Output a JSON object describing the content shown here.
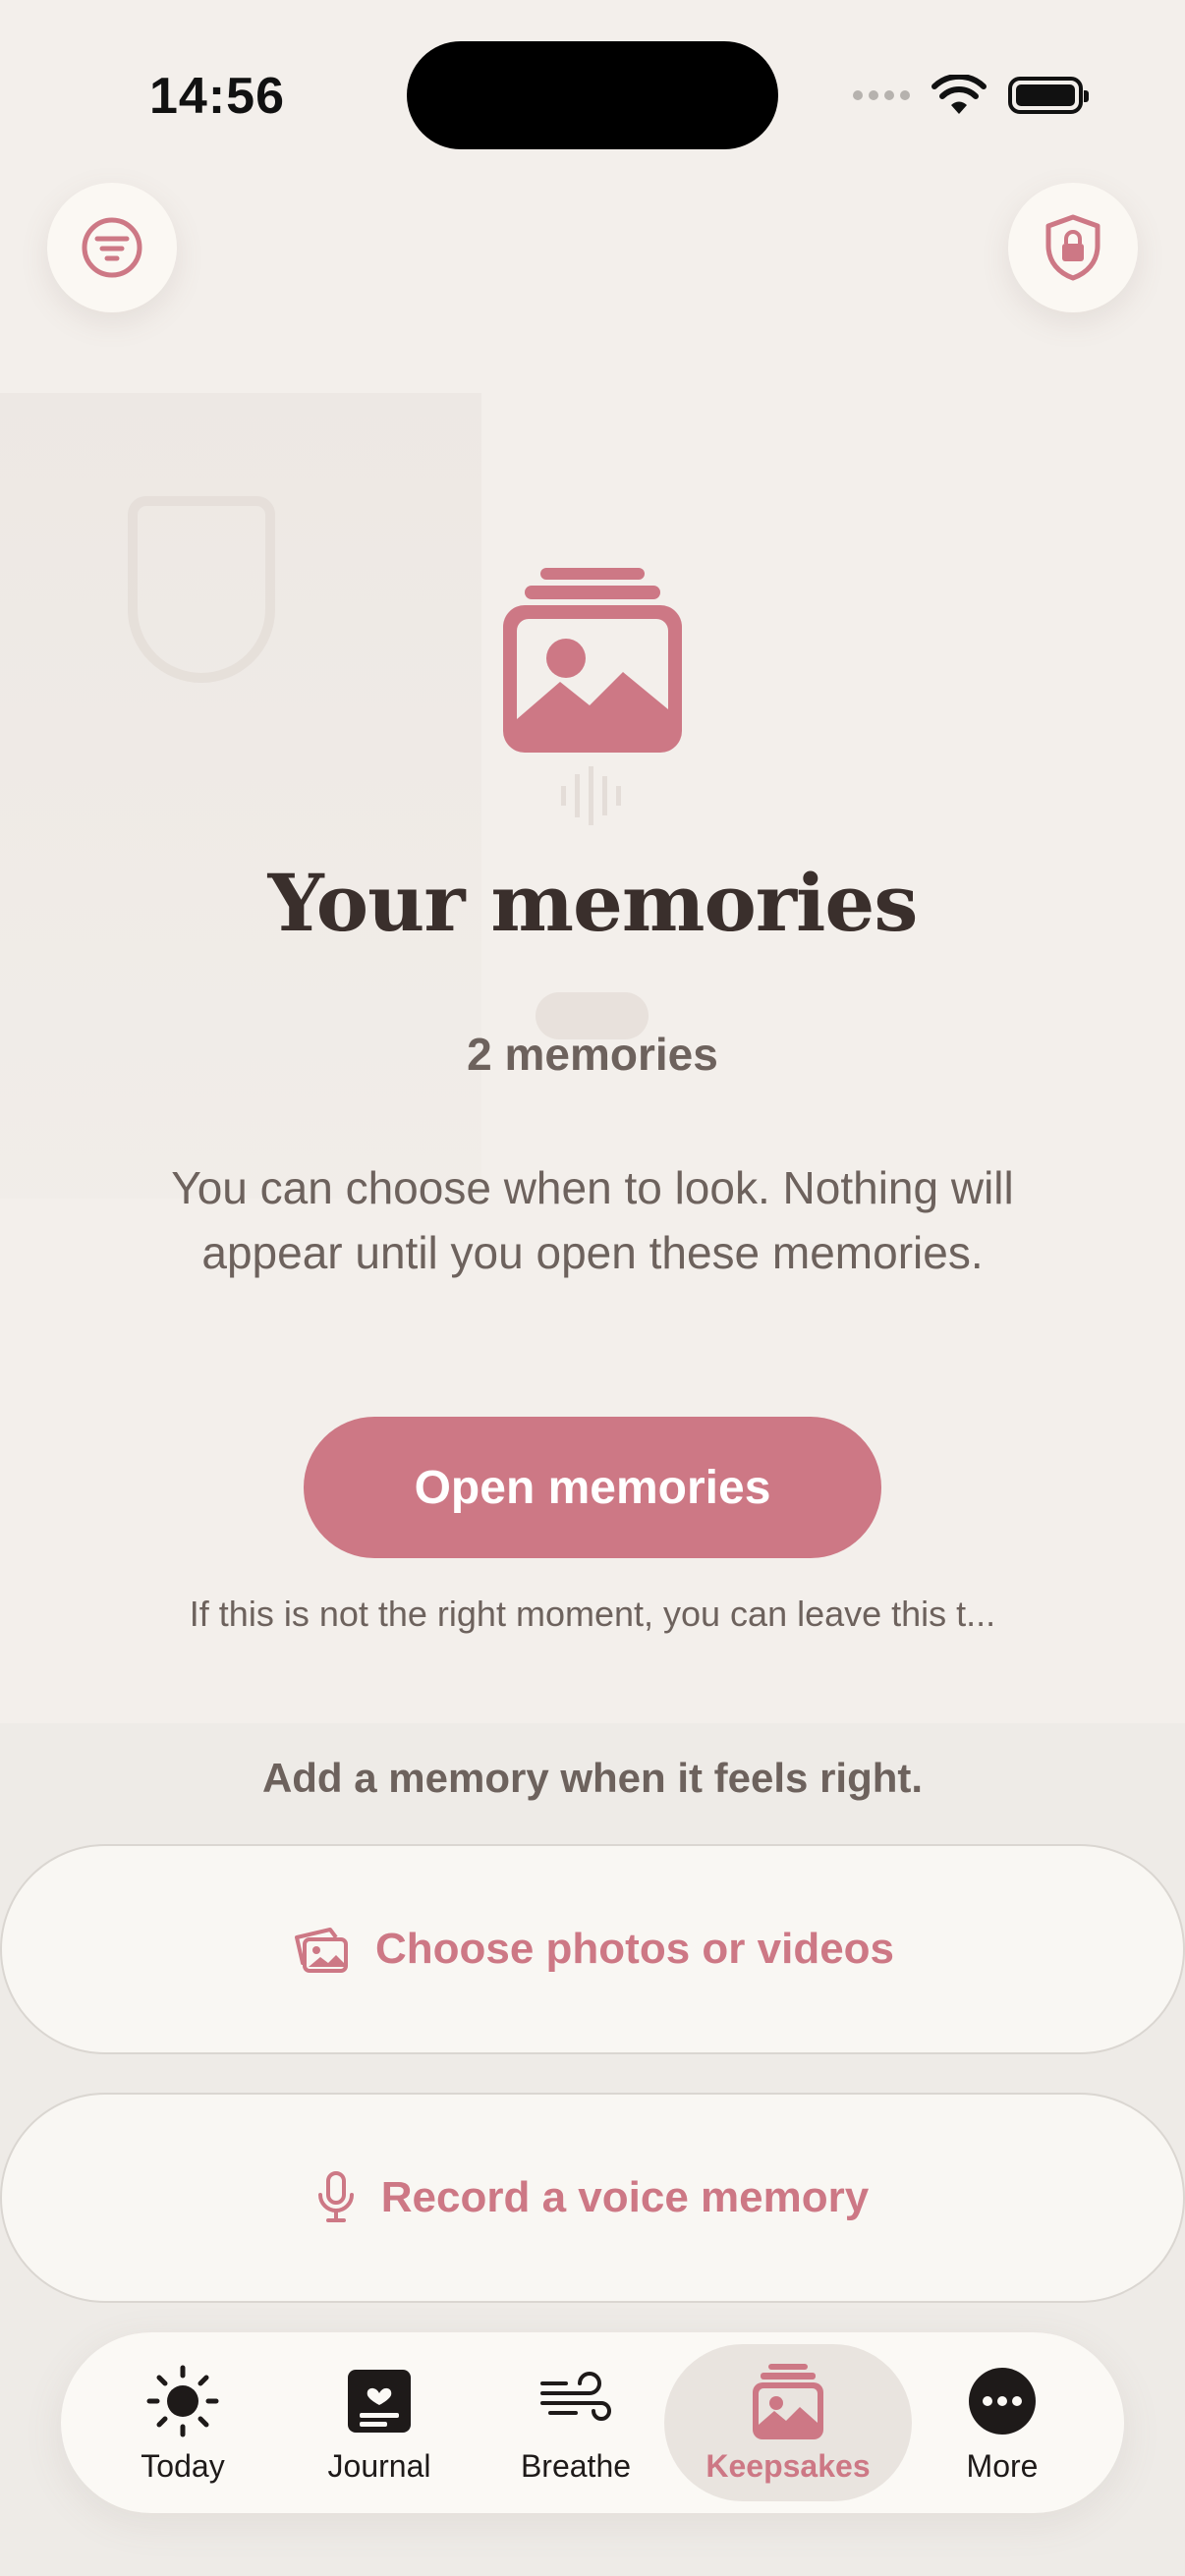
{
  "status_bar": {
    "time": "14:56"
  },
  "header": {
    "filter_icon": "filter-icon",
    "privacy_icon": "shield-lock-icon"
  },
  "hero": {
    "icon": "photo-stack-icon",
    "title": "Your memories",
    "count": "2 memories",
    "description": "You can choose when to look. Nothing will appear until you open these memories.",
    "open_label": "Open memories",
    "leave_note": "If this is not the right moment, you can leave this t..."
  },
  "add": {
    "prompt": "Add a memory when it feels right.",
    "photos_label": "Choose photos or videos",
    "photos_icon": "photos-icon",
    "voice_label": "Record a voice memory",
    "voice_icon": "microphone-icon"
  },
  "tabs": [
    {
      "label": "Today",
      "icon": "sun-icon"
    },
    {
      "label": "Journal",
      "icon": "journal-icon"
    },
    {
      "label": "Breathe",
      "icon": "wind-icon"
    },
    {
      "label": "Keepsakes",
      "icon": "photo-stack-icon",
      "active": true
    },
    {
      "label": "More",
      "icon": "more-icon"
    }
  ],
  "colors": {
    "accent": "#cd7885",
    "background": "#f3efeb",
    "text": "#3a2f2c"
  }
}
